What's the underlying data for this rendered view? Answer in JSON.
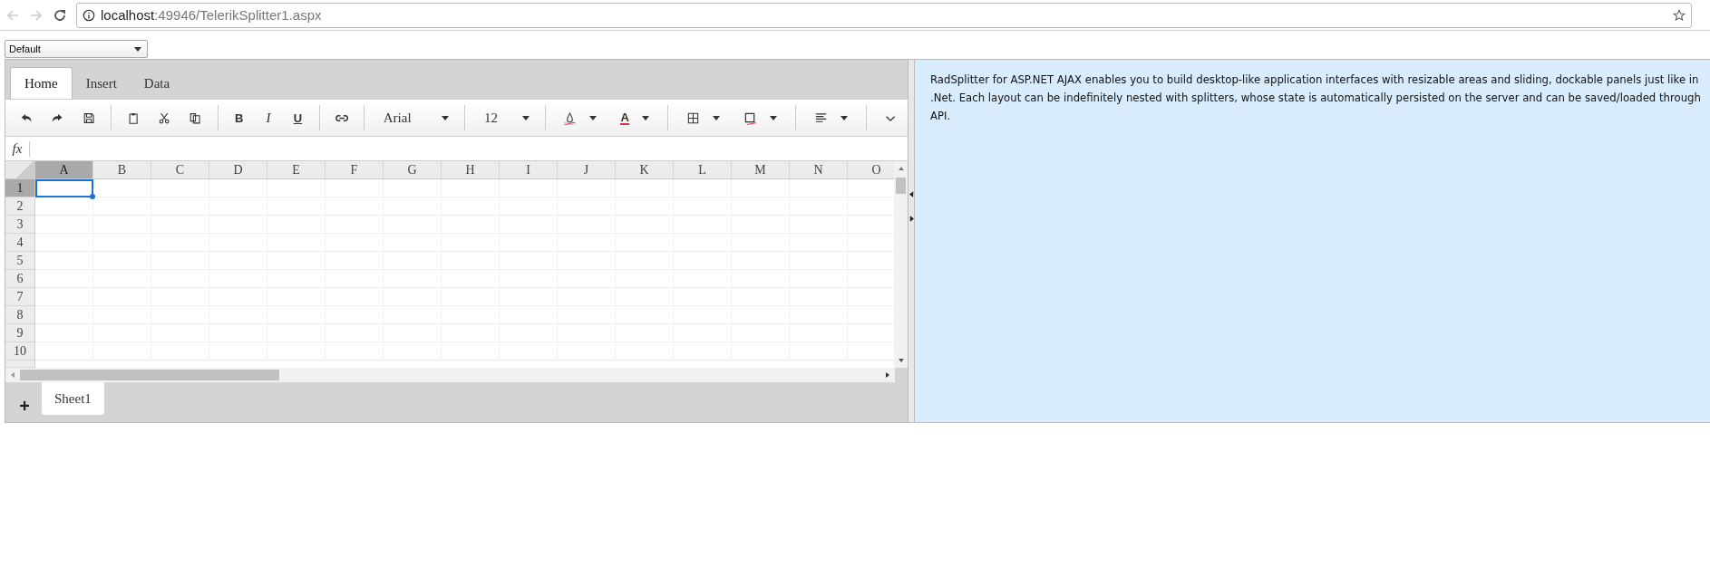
{
  "browser": {
    "url_host": "localhost",
    "url_path": ":49946/TelerikSplitter1.aspx"
  },
  "skin_select": {
    "value": "Default"
  },
  "spreadsheet": {
    "tabs": [
      {
        "label": "Home",
        "selected": true
      },
      {
        "label": "Insert",
        "selected": false
      },
      {
        "label": "Data",
        "selected": false
      }
    ],
    "toolbar": {
      "bold": "B",
      "italic": "I",
      "underline": "U",
      "font": "Arial",
      "font_size": "12",
      "text_color": "A"
    },
    "formula_bar": {
      "label": "fx"
    },
    "columns": [
      {
        "label": "A",
        "selected": true
      },
      {
        "label": "B",
        "selected": false
      },
      {
        "label": "C",
        "selected": false
      },
      {
        "label": "D",
        "selected": false
      },
      {
        "label": "E",
        "selected": false
      },
      {
        "label": "F",
        "selected": false
      },
      {
        "label": "G",
        "selected": false
      },
      {
        "label": "H",
        "selected": false
      },
      {
        "label": "I",
        "selected": false
      },
      {
        "label": "J",
        "selected": false
      },
      {
        "label": "K",
        "selected": false
      },
      {
        "label": "L",
        "selected": false
      },
      {
        "label": "M",
        "selected": false
      },
      {
        "label": "N",
        "selected": false
      },
      {
        "label": "O",
        "selected": false
      }
    ],
    "rows": [
      {
        "label": "1",
        "selected": true
      },
      {
        "label": "2",
        "selected": false
      },
      {
        "label": "3",
        "selected": false
      },
      {
        "label": "4",
        "selected": false
      },
      {
        "label": "5",
        "selected": false
      },
      {
        "label": "6",
        "selected": false
      },
      {
        "label": "7",
        "selected": false
      },
      {
        "label": "8",
        "selected": false
      },
      {
        "label": "9",
        "selected": false
      },
      {
        "label": "10",
        "selected": false
      }
    ],
    "add_sheet": "+",
    "sheets": [
      {
        "label": "Sheet1",
        "selected": true
      }
    ]
  },
  "side_pane": {
    "lines": [
      "RadSplitter for ASP.NET AJAX enables you to build desktop-like application interfaces with resizable areas and sliding, dockable panels just like in",
      ".Net. Each layout can be indefinitely nested with splitters, whose state is automatically persisted on the server and can be saved/loaded through",
      "API."
    ]
  }
}
